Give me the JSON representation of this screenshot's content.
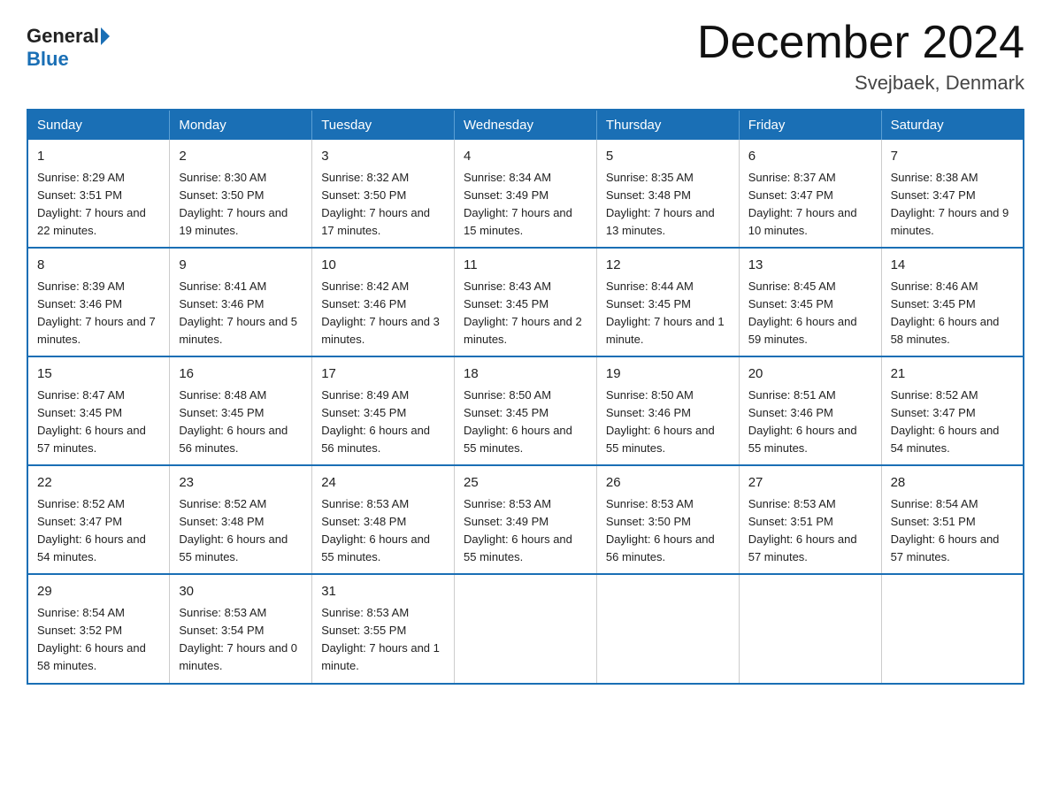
{
  "logo": {
    "general": "General",
    "blue": "Blue"
  },
  "header": {
    "month": "December 2024",
    "location": "Svejbaek, Denmark"
  },
  "weekdays": [
    "Sunday",
    "Monday",
    "Tuesday",
    "Wednesday",
    "Thursday",
    "Friday",
    "Saturday"
  ],
  "weeks": [
    [
      {
        "day": "1",
        "sunrise": "8:29 AM",
        "sunset": "3:51 PM",
        "daylight": "7 hours and 22 minutes."
      },
      {
        "day": "2",
        "sunrise": "8:30 AM",
        "sunset": "3:50 PM",
        "daylight": "7 hours and 19 minutes."
      },
      {
        "day": "3",
        "sunrise": "8:32 AM",
        "sunset": "3:50 PM",
        "daylight": "7 hours and 17 minutes."
      },
      {
        "day": "4",
        "sunrise": "8:34 AM",
        "sunset": "3:49 PM",
        "daylight": "7 hours and 15 minutes."
      },
      {
        "day": "5",
        "sunrise": "8:35 AM",
        "sunset": "3:48 PM",
        "daylight": "7 hours and 13 minutes."
      },
      {
        "day": "6",
        "sunrise": "8:37 AM",
        "sunset": "3:47 PM",
        "daylight": "7 hours and 10 minutes."
      },
      {
        "day": "7",
        "sunrise": "8:38 AM",
        "sunset": "3:47 PM",
        "daylight": "7 hours and 9 minutes."
      }
    ],
    [
      {
        "day": "8",
        "sunrise": "8:39 AM",
        "sunset": "3:46 PM",
        "daylight": "7 hours and 7 minutes."
      },
      {
        "day": "9",
        "sunrise": "8:41 AM",
        "sunset": "3:46 PM",
        "daylight": "7 hours and 5 minutes."
      },
      {
        "day": "10",
        "sunrise": "8:42 AM",
        "sunset": "3:46 PM",
        "daylight": "7 hours and 3 minutes."
      },
      {
        "day": "11",
        "sunrise": "8:43 AM",
        "sunset": "3:45 PM",
        "daylight": "7 hours and 2 minutes."
      },
      {
        "day": "12",
        "sunrise": "8:44 AM",
        "sunset": "3:45 PM",
        "daylight": "7 hours and 1 minute."
      },
      {
        "day": "13",
        "sunrise": "8:45 AM",
        "sunset": "3:45 PM",
        "daylight": "6 hours and 59 minutes."
      },
      {
        "day": "14",
        "sunrise": "8:46 AM",
        "sunset": "3:45 PM",
        "daylight": "6 hours and 58 minutes."
      }
    ],
    [
      {
        "day": "15",
        "sunrise": "8:47 AM",
        "sunset": "3:45 PM",
        "daylight": "6 hours and 57 minutes."
      },
      {
        "day": "16",
        "sunrise": "8:48 AM",
        "sunset": "3:45 PM",
        "daylight": "6 hours and 56 minutes."
      },
      {
        "day": "17",
        "sunrise": "8:49 AM",
        "sunset": "3:45 PM",
        "daylight": "6 hours and 56 minutes."
      },
      {
        "day": "18",
        "sunrise": "8:50 AM",
        "sunset": "3:45 PM",
        "daylight": "6 hours and 55 minutes."
      },
      {
        "day": "19",
        "sunrise": "8:50 AM",
        "sunset": "3:46 PM",
        "daylight": "6 hours and 55 minutes."
      },
      {
        "day": "20",
        "sunrise": "8:51 AM",
        "sunset": "3:46 PM",
        "daylight": "6 hours and 55 minutes."
      },
      {
        "day": "21",
        "sunrise": "8:52 AM",
        "sunset": "3:47 PM",
        "daylight": "6 hours and 54 minutes."
      }
    ],
    [
      {
        "day": "22",
        "sunrise": "8:52 AM",
        "sunset": "3:47 PM",
        "daylight": "6 hours and 54 minutes."
      },
      {
        "day": "23",
        "sunrise": "8:52 AM",
        "sunset": "3:48 PM",
        "daylight": "6 hours and 55 minutes."
      },
      {
        "day": "24",
        "sunrise": "8:53 AM",
        "sunset": "3:48 PM",
        "daylight": "6 hours and 55 minutes."
      },
      {
        "day": "25",
        "sunrise": "8:53 AM",
        "sunset": "3:49 PM",
        "daylight": "6 hours and 55 minutes."
      },
      {
        "day": "26",
        "sunrise": "8:53 AM",
        "sunset": "3:50 PM",
        "daylight": "6 hours and 56 minutes."
      },
      {
        "day": "27",
        "sunrise": "8:53 AM",
        "sunset": "3:51 PM",
        "daylight": "6 hours and 57 minutes."
      },
      {
        "day": "28",
        "sunrise": "8:54 AM",
        "sunset": "3:51 PM",
        "daylight": "6 hours and 57 minutes."
      }
    ],
    [
      {
        "day": "29",
        "sunrise": "8:54 AM",
        "sunset": "3:52 PM",
        "daylight": "6 hours and 58 minutes."
      },
      {
        "day": "30",
        "sunrise": "8:53 AM",
        "sunset": "3:54 PM",
        "daylight": "7 hours and 0 minutes."
      },
      {
        "day": "31",
        "sunrise": "8:53 AM",
        "sunset": "3:55 PM",
        "daylight": "7 hours and 1 minute."
      },
      null,
      null,
      null,
      null
    ]
  ],
  "labels": {
    "sunrise": "Sunrise:",
    "sunset": "Sunset:",
    "daylight": "Daylight:"
  }
}
